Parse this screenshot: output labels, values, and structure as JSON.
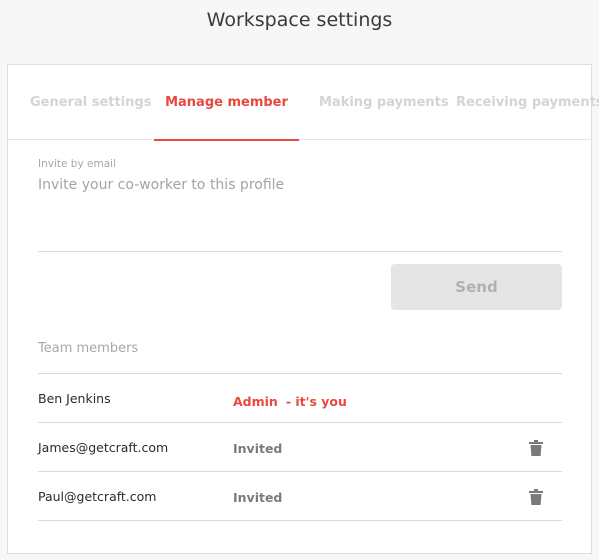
{
  "page": {
    "title": "Workspace settings"
  },
  "tabs": [
    {
      "label": "General settings",
      "active": false
    },
    {
      "label": "Manage member",
      "active": true
    },
    {
      "label": "Making payments",
      "active": false
    },
    {
      "label": "Receiving payments",
      "active": false
    }
  ],
  "invite": {
    "label": "Invite by email",
    "placeholder": "Invite your co-worker to this profile",
    "value": "",
    "send_label": "Send"
  },
  "team": {
    "heading": "Team members",
    "members": [
      {
        "name": "Ben Jenkins",
        "role": "Admin",
        "note": "- it's you",
        "deletable": false
      },
      {
        "name": "James@getcraft.com",
        "role": "Invited",
        "note": "",
        "deletable": true,
        "action_icon": "trash-icon"
      },
      {
        "name": "Paul@getcraft.com",
        "role": "Invited",
        "note": "",
        "deletable": true,
        "action_icon": "trash-icon"
      }
    ]
  },
  "colors": {
    "accent": "#e8483f",
    "tab_inactive": "#d4d4d4",
    "button_disabled_bg": "#e5e5e5",
    "button_disabled_text": "#b0b0b0"
  }
}
